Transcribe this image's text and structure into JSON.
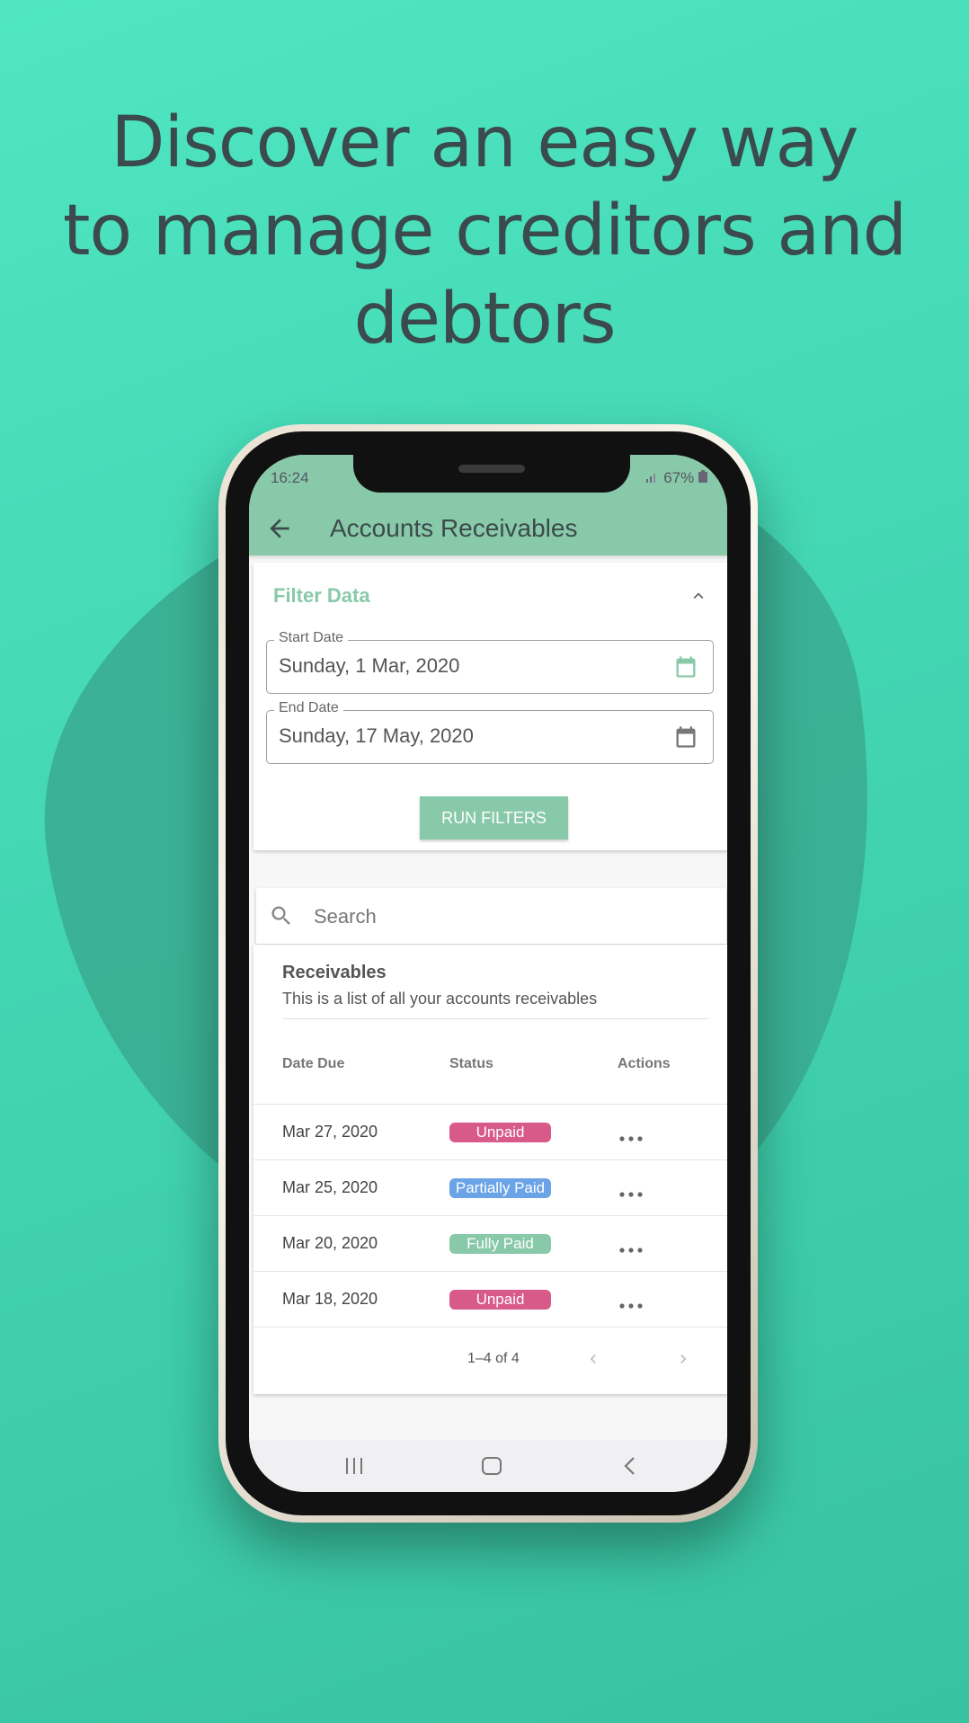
{
  "headline": {
    "line1": "Discover an easy way",
    "line2": "to manage creditors and",
    "line3": "debtors"
  },
  "colors": {
    "background": "#48dcb8",
    "accent_green": "#88c9a9",
    "unpaid": "#d85a88",
    "partially_paid": "#6aa3e6",
    "fully_paid": "#88c9a9"
  },
  "status_bar": {
    "time": "16:24",
    "battery": "67%"
  },
  "app_bar": {
    "title": "Accounts Receivables",
    "back_icon": "arrow-left-icon"
  },
  "filter": {
    "title": "Filter Data",
    "start_label": "Start Date",
    "start_value": "Sunday, 1 Mar, 2020",
    "end_label": "End Date",
    "end_value": "Sunday, 17 May, 2020",
    "run_label": "RUN FILTERS"
  },
  "search": {
    "placeholder": "Search"
  },
  "list": {
    "title": "Receivables",
    "subtitle": "This is a list of all your accounts receivables",
    "columns": [
      "Date Due",
      "Status",
      "Actions"
    ],
    "rows": [
      {
        "date": "Mar 27, 2020",
        "status": "Unpaid"
      },
      {
        "date": "Mar 25, 2020",
        "status": "Partially Paid"
      },
      {
        "date": "Mar 20, 2020",
        "status": "Fully Paid"
      },
      {
        "date": "Mar 18, 2020",
        "status": "Unpaid"
      }
    ],
    "pagination": "1–4 of 4"
  }
}
